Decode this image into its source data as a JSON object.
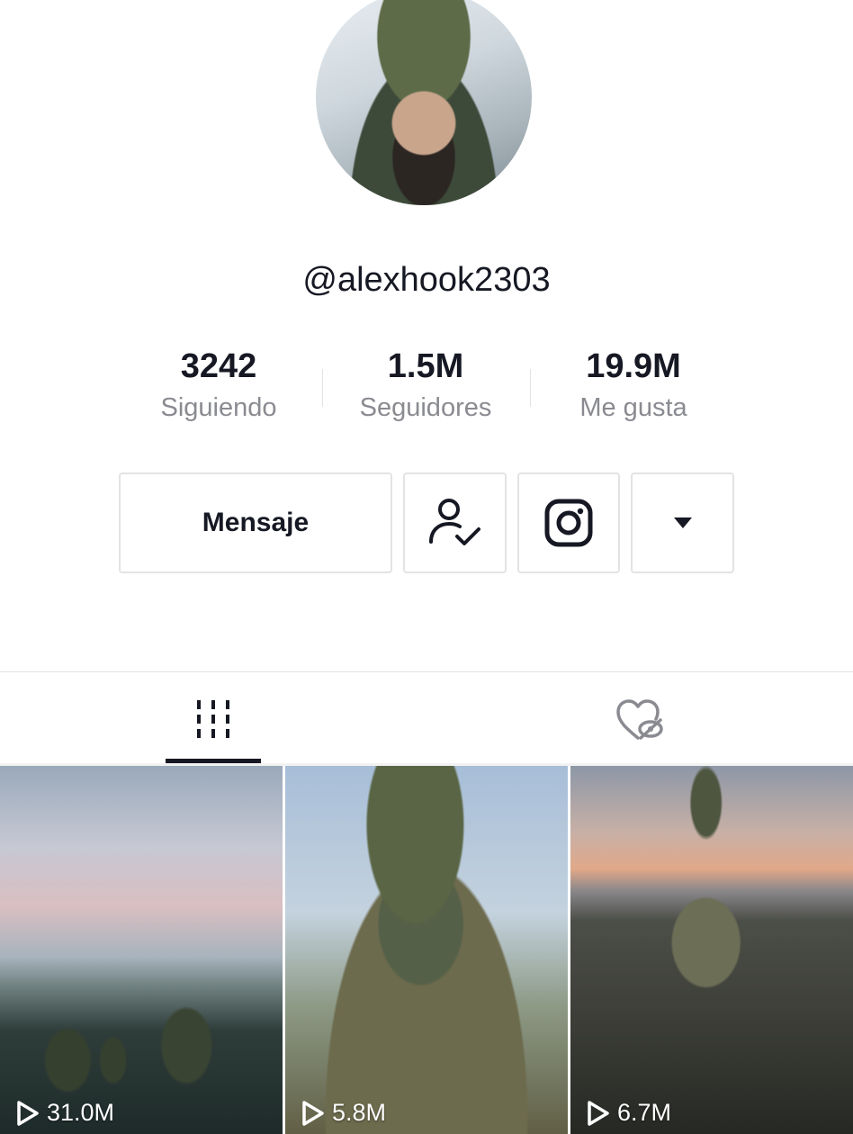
{
  "profile": {
    "username": "@alexhook2303",
    "avatar_alt": "profile-photo"
  },
  "stats": [
    {
      "value": "3242",
      "label": "Siguiendo"
    },
    {
      "value": "1.5M",
      "label": "Seguidores"
    },
    {
      "value": "19.9M",
      "label": "Me gusta"
    }
  ],
  "actions": {
    "message_label": "Mensaje",
    "follow_icon": "user-check-icon",
    "instagram_icon": "instagram-icon",
    "more_icon": "caret-down-icon"
  },
  "tabs": [
    {
      "icon": "videos-grid-icon",
      "active": true
    },
    {
      "icon": "liked-hidden-icon",
      "active": false
    }
  ],
  "videos": [
    {
      "views": "31.0M"
    },
    {
      "views": "5.8M"
    },
    {
      "views": "6.7M"
    }
  ],
  "colors": {
    "text": "#161823",
    "muted": "#8a8b91",
    "border": "#e3e3e4"
  }
}
